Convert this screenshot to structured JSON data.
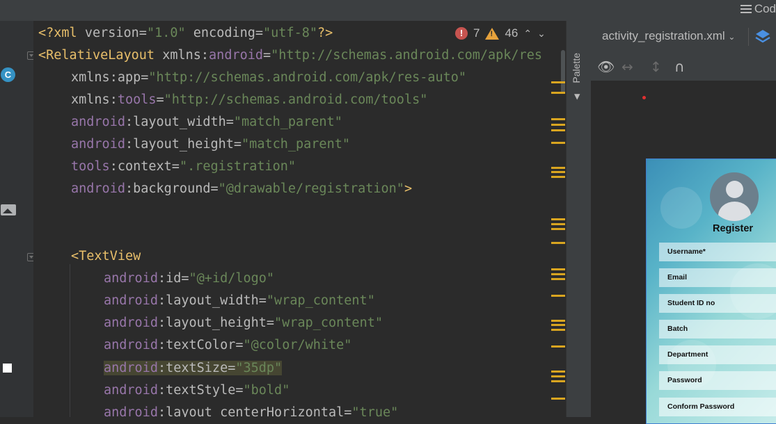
{
  "toolbar": {
    "code_label": "Cod"
  },
  "editor": {
    "lines": [
      {
        "parts": [
          [
            "c-tag",
            "<?xml "
          ],
          [
            "c-attr",
            "version="
          ],
          [
            "c-val",
            "\"1.0\""
          ],
          [
            "c-attr",
            " encoding="
          ],
          [
            "c-val",
            "\"utf-8\""
          ],
          [
            "c-tag",
            "?>"
          ]
        ]
      },
      {
        "parts": [
          [
            "c-tag",
            "<RelativeLayout "
          ],
          [
            "c-attr",
            "xmlns:"
          ],
          [
            "c-ns",
            "android"
          ],
          [
            "c-attr",
            "="
          ],
          [
            "c-val",
            "\"http://schemas.android.com/apk/res"
          ]
        ]
      },
      {
        "parts": [
          [
            "c-attr",
            "xmlns:app="
          ],
          [
            "c-val",
            "\"http://schemas.android.com/apk/res-auto\""
          ]
        ]
      },
      {
        "parts": [
          [
            "c-attr",
            "xmlns:"
          ],
          [
            "c-ns",
            "tools"
          ],
          [
            "c-attr",
            "="
          ],
          [
            "c-val",
            "\"http://schemas.android.com/tools\""
          ]
        ]
      },
      {
        "parts": [
          [
            "c-ns",
            "android"
          ],
          [
            "c-attr",
            ":layout_width="
          ],
          [
            "c-val",
            "\"match_parent\""
          ]
        ]
      },
      {
        "parts": [
          [
            "c-ns",
            "android"
          ],
          [
            "c-attr",
            ":layout_height="
          ],
          [
            "c-val",
            "\"match_parent\""
          ]
        ]
      },
      {
        "parts": [
          [
            "c-ns",
            "tools"
          ],
          [
            "c-attr",
            ":context="
          ],
          [
            "c-val",
            "\".registration\""
          ]
        ]
      },
      {
        "parts": [
          [
            "c-ns",
            "android"
          ],
          [
            "c-attr",
            ":background="
          ],
          [
            "c-val",
            "\"@drawable/registration\""
          ],
          [
            "c-tag",
            ">"
          ]
        ]
      },
      {
        "parts": []
      },
      {
        "parts": []
      },
      {
        "parts": [
          [
            "c-tag",
            "<TextView"
          ]
        ]
      },
      {
        "parts": [
          [
            "c-ns",
            "android"
          ],
          [
            "c-attr",
            ":id="
          ],
          [
            "c-val",
            "\"@+id/logo\""
          ]
        ]
      },
      {
        "parts": [
          [
            "c-ns",
            "android"
          ],
          [
            "c-attr",
            ":layout_width="
          ],
          [
            "c-val",
            "\"wrap_content\""
          ]
        ]
      },
      {
        "parts": [
          [
            "c-ns",
            "android"
          ],
          [
            "c-attr",
            ":layout_height="
          ],
          [
            "c-val",
            "\"wrap_content\""
          ]
        ]
      },
      {
        "parts": [
          [
            "c-ns",
            "android"
          ],
          [
            "c-attr",
            ":textColor="
          ],
          [
            "c-val",
            "\"@color/white\""
          ]
        ]
      },
      {
        "parts": [
          [
            "c-ns",
            "android"
          ],
          [
            "c-attr",
            ":textSize="
          ],
          [
            "c-val",
            "\"35dp\""
          ]
        ],
        "highlight": true
      },
      {
        "parts": [
          [
            "c-ns",
            "android"
          ],
          [
            "c-attr",
            ":textStyle="
          ],
          [
            "c-val",
            "\"bold\""
          ]
        ]
      },
      {
        "parts": [
          [
            "c-ns",
            "android"
          ],
          [
            "c-attr",
            ":layout_centerHorizontal="
          ],
          [
            "c-val",
            "\"true\""
          ]
        ]
      }
    ]
  },
  "inspection": {
    "errors": "7",
    "warnings": "46"
  },
  "palette": {
    "label": "Palette"
  },
  "design": {
    "file_name": "activity_registration.xml",
    "preview": {
      "title": "Register",
      "fields": [
        "Username*",
        "Email",
        "Student ID no",
        "Batch",
        "Department",
        "Password",
        "Conform Password"
      ]
    }
  },
  "icons": [
    "error-icon",
    "warning-icon",
    "chevron-up-icon",
    "chevron-down-icon",
    "eye-icon",
    "layers-icon",
    "hamburger-icon",
    "image-icon",
    "class-icon"
  ]
}
